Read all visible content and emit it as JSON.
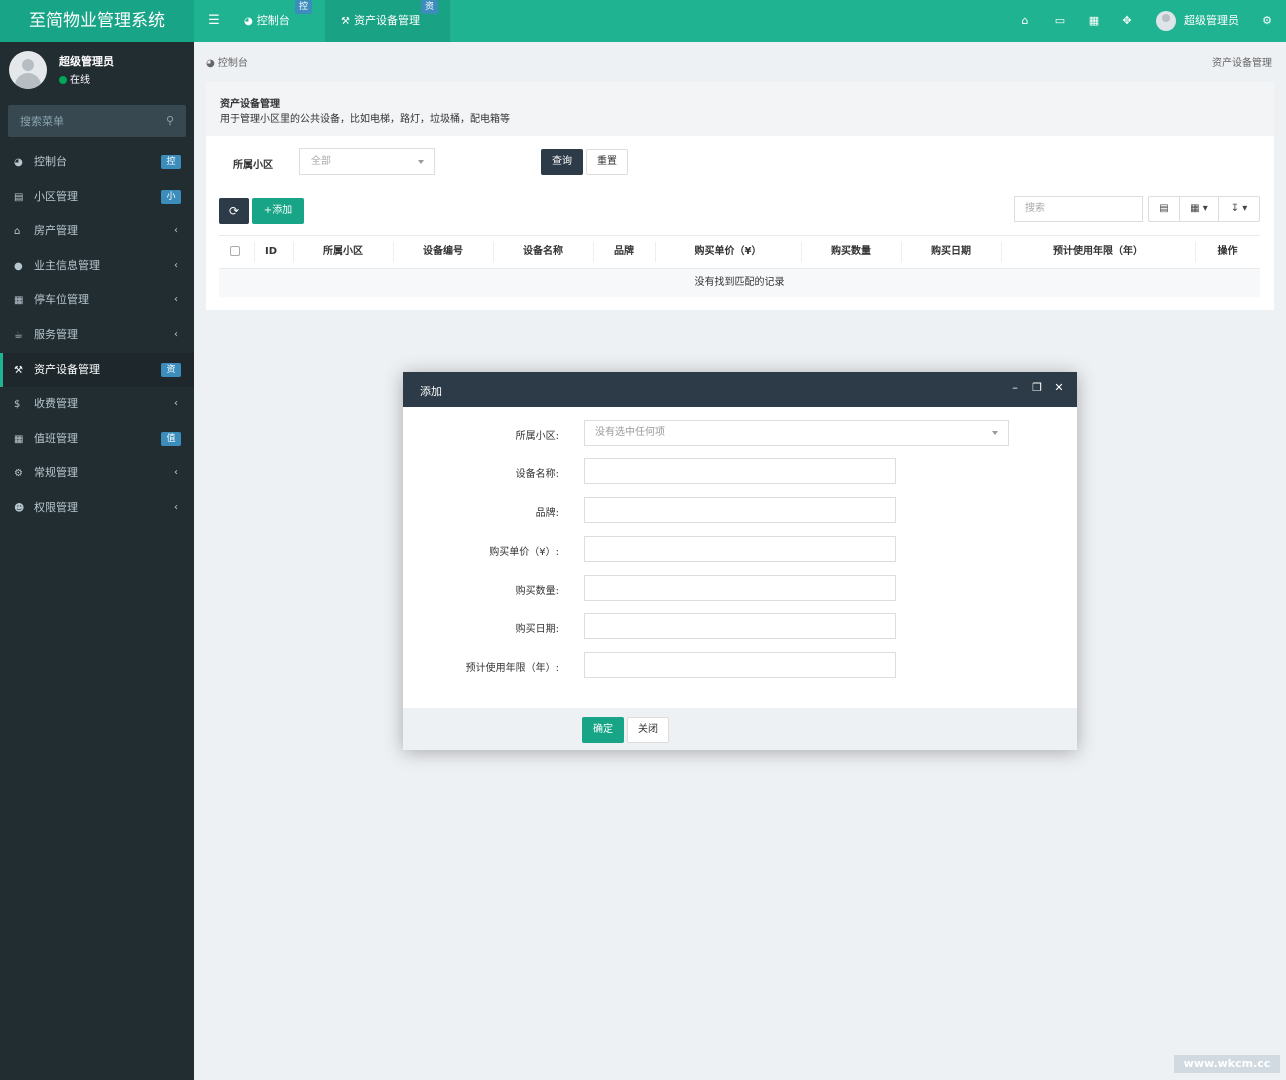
{
  "app": {
    "title": "至简物业管理系统",
    "watermark": "www.wkcm.cc"
  },
  "topbar": {
    "menu_icon": "hamburger-icon",
    "tabs": [
      {
        "label": "控制台",
        "badge": "控",
        "icon": "dashboard-icon"
      },
      {
        "label": "资产设备管理",
        "badge": "资",
        "icon": "wrench-icon"
      }
    ],
    "icons": [
      "home-icon",
      "trash-icon",
      "language-icon",
      "fullscreen-icon",
      "settings-icon"
    ],
    "user": "超级管理员"
  },
  "sidebar": {
    "user_name": "超级管理员",
    "status": "在线",
    "search_placeholder": "搜索菜单",
    "items": [
      {
        "label": "控制台",
        "badge": "控",
        "icon": "dashboard-icon"
      },
      {
        "label": "小区管理",
        "badge": "小",
        "icon": "list-icon"
      },
      {
        "label": "房产管理",
        "icon": "home-icon"
      },
      {
        "label": "业主信息管理",
        "icon": "user-icon"
      },
      {
        "label": "停车位管理",
        "icon": "film-icon"
      },
      {
        "label": "服务管理",
        "icon": "coffee-icon"
      },
      {
        "label": "资产设备管理",
        "badge": "资",
        "icon": "wrench-icon",
        "active": true
      },
      {
        "label": "收费管理",
        "icon": "dollar-icon"
      },
      {
        "label": "值班管理",
        "badge": "值",
        "icon": "calendar-icon"
      },
      {
        "label": "常规管理",
        "icon": "gears-icon"
      },
      {
        "label": "权限管理",
        "icon": "group-icon"
      }
    ],
    "accent": "#1fb392"
  },
  "breadcrumb": {
    "home": "控制台",
    "current": "资产设备管理"
  },
  "panel": {
    "title": "资产设备管理",
    "description": "用于管理小区里的公共设备，比如电梯，路灯，垃圾桶，配电箱等",
    "filter_label": "所属小区",
    "filter_value": "全部",
    "query_label": "查询",
    "reset_label": "重置",
    "add_label": "添加",
    "search_placeholder": "搜索",
    "columns": [
      "ID",
      "所属小区",
      "设备编号",
      "设备名称",
      "品牌",
      "购买单价（¥）",
      "购买数量",
      "购买日期",
      "预计使用年限（年）",
      "操作"
    ],
    "empty_text": "没有找到匹配的记录"
  },
  "modal": {
    "title": "添加",
    "fields": {
      "community_label": "所属小区:",
      "community_placeholder": "没有选中任何项",
      "name_label": "设备名称:",
      "brand_label": "品牌:",
      "price_label": "购买单价（¥）:",
      "quantity_label": "购买数量:",
      "date_label": "购买日期:",
      "years_label": "预计使用年限（年）:"
    },
    "ok_label": "确定",
    "close_label": "关闭"
  },
  "colors": {
    "brand": "#1fb392",
    "dark": "#2c3b47",
    "sidebar": "#222d32",
    "badge": "#3c8dbc"
  }
}
